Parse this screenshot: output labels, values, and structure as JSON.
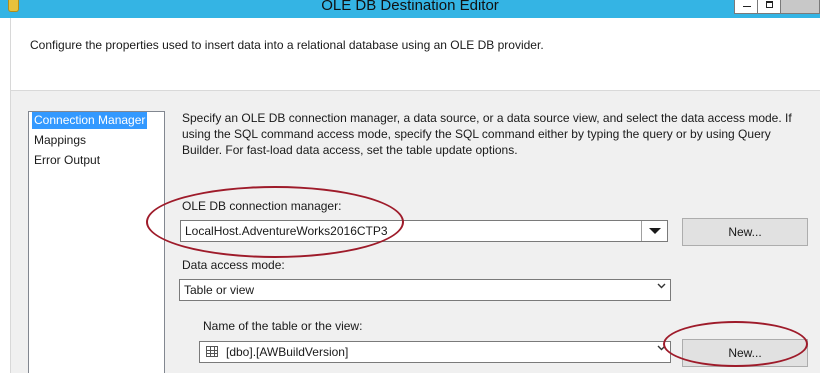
{
  "window": {
    "title": "OLE DB Destination Editor"
  },
  "header": {
    "description": "Configure the properties used to insert data into a relational database using an OLE DB provider."
  },
  "nav": {
    "items": [
      {
        "label": "Connection Manager",
        "selected": true
      },
      {
        "label": "Mappings",
        "selected": false
      },
      {
        "label": "Error Output",
        "selected": false
      }
    ]
  },
  "content": {
    "instructions": "Specify an OLE DB connection manager, a data source, or a data source view, and select the data access mode. If using the SQL command access mode, specify the SQL command either by typing the query or by using Query Builder. For fast-load data access, set the table update options.",
    "connection_label": "OLE DB connection manager:",
    "connection_value": "LocalHost.AdventureWorks2016CTP3",
    "connection_new_button": "New...",
    "access_mode_label": "Data access mode:",
    "access_mode_value": "Table or view",
    "table_label": "Name of the table or the view:",
    "table_value": "[dbo].[AWBuildVersion]",
    "table_new_button": "New..."
  },
  "colors": {
    "titlebar": "#34b4e4",
    "selection": "#3399ff",
    "annotation": "#9e1b2a"
  },
  "icons": {
    "app": "package-icon",
    "table": "table-icon"
  }
}
